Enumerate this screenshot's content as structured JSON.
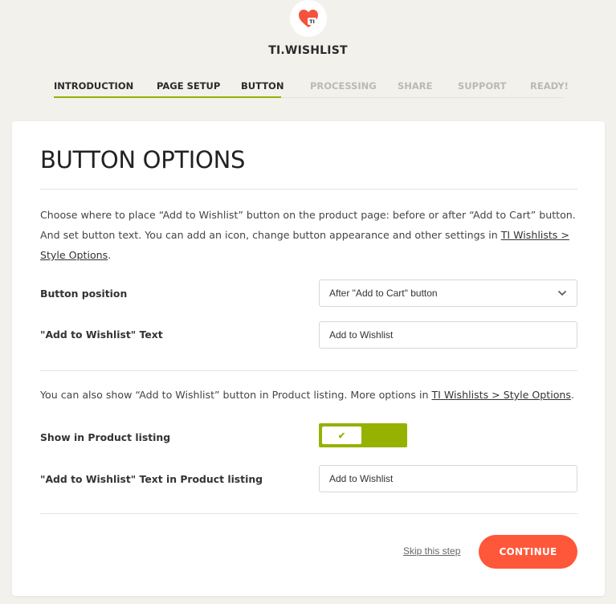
{
  "brand": {
    "name": "TI.WISHLIST",
    "logo_icon": "heart-icon",
    "logo_text": "TI"
  },
  "steps": [
    {
      "label": "INTRODUCTION",
      "state": "done"
    },
    {
      "label": "PAGE SETUP",
      "state": "done"
    },
    {
      "label": "BUTTON",
      "state": "current"
    },
    {
      "label": "PROCESSING",
      "state": "todo"
    },
    {
      "label": "SHARE",
      "state": "todo"
    },
    {
      "label": "SUPPORT",
      "state": "todo"
    },
    {
      "label": "READY!",
      "state": "todo"
    }
  ],
  "card": {
    "title": "BUTTON OPTIONS",
    "intro_line1": "Choose where to place “Add to Wishlist” button on the product page: before or after “Add to Cart” button.",
    "intro_line2": "And set button text. You can add an icon, change button appearance and other settings in ",
    "intro_link_a": "TI Wishlists >",
    "intro_link_b": "Style Options",
    "intro_end": ".",
    "button_position_label": "Button position",
    "button_position_value": "After \"Add to Cart\" button",
    "button_text_label": "\"Add to Wishlist\" Text",
    "button_text_value": "Add to Wishlist",
    "note_text": "You can also show “Add to Wishlist” button in Product listing. More options in ",
    "note_link": "TI Wishlists > Style Options",
    "note_end": ".",
    "show_listing_label": "Show in Product listing",
    "show_listing_on": true,
    "listing_text_label": "\"Add to Wishlist\" Text in Product listing",
    "listing_text_value": "Add to Wishlist",
    "skip_label": "Skip this step",
    "continue_label": "CONTINUE"
  },
  "colors": {
    "accent": "#96b100",
    "cta": "#ff5739",
    "logo": "#f4523b",
    "background": "#f3f1ec"
  }
}
